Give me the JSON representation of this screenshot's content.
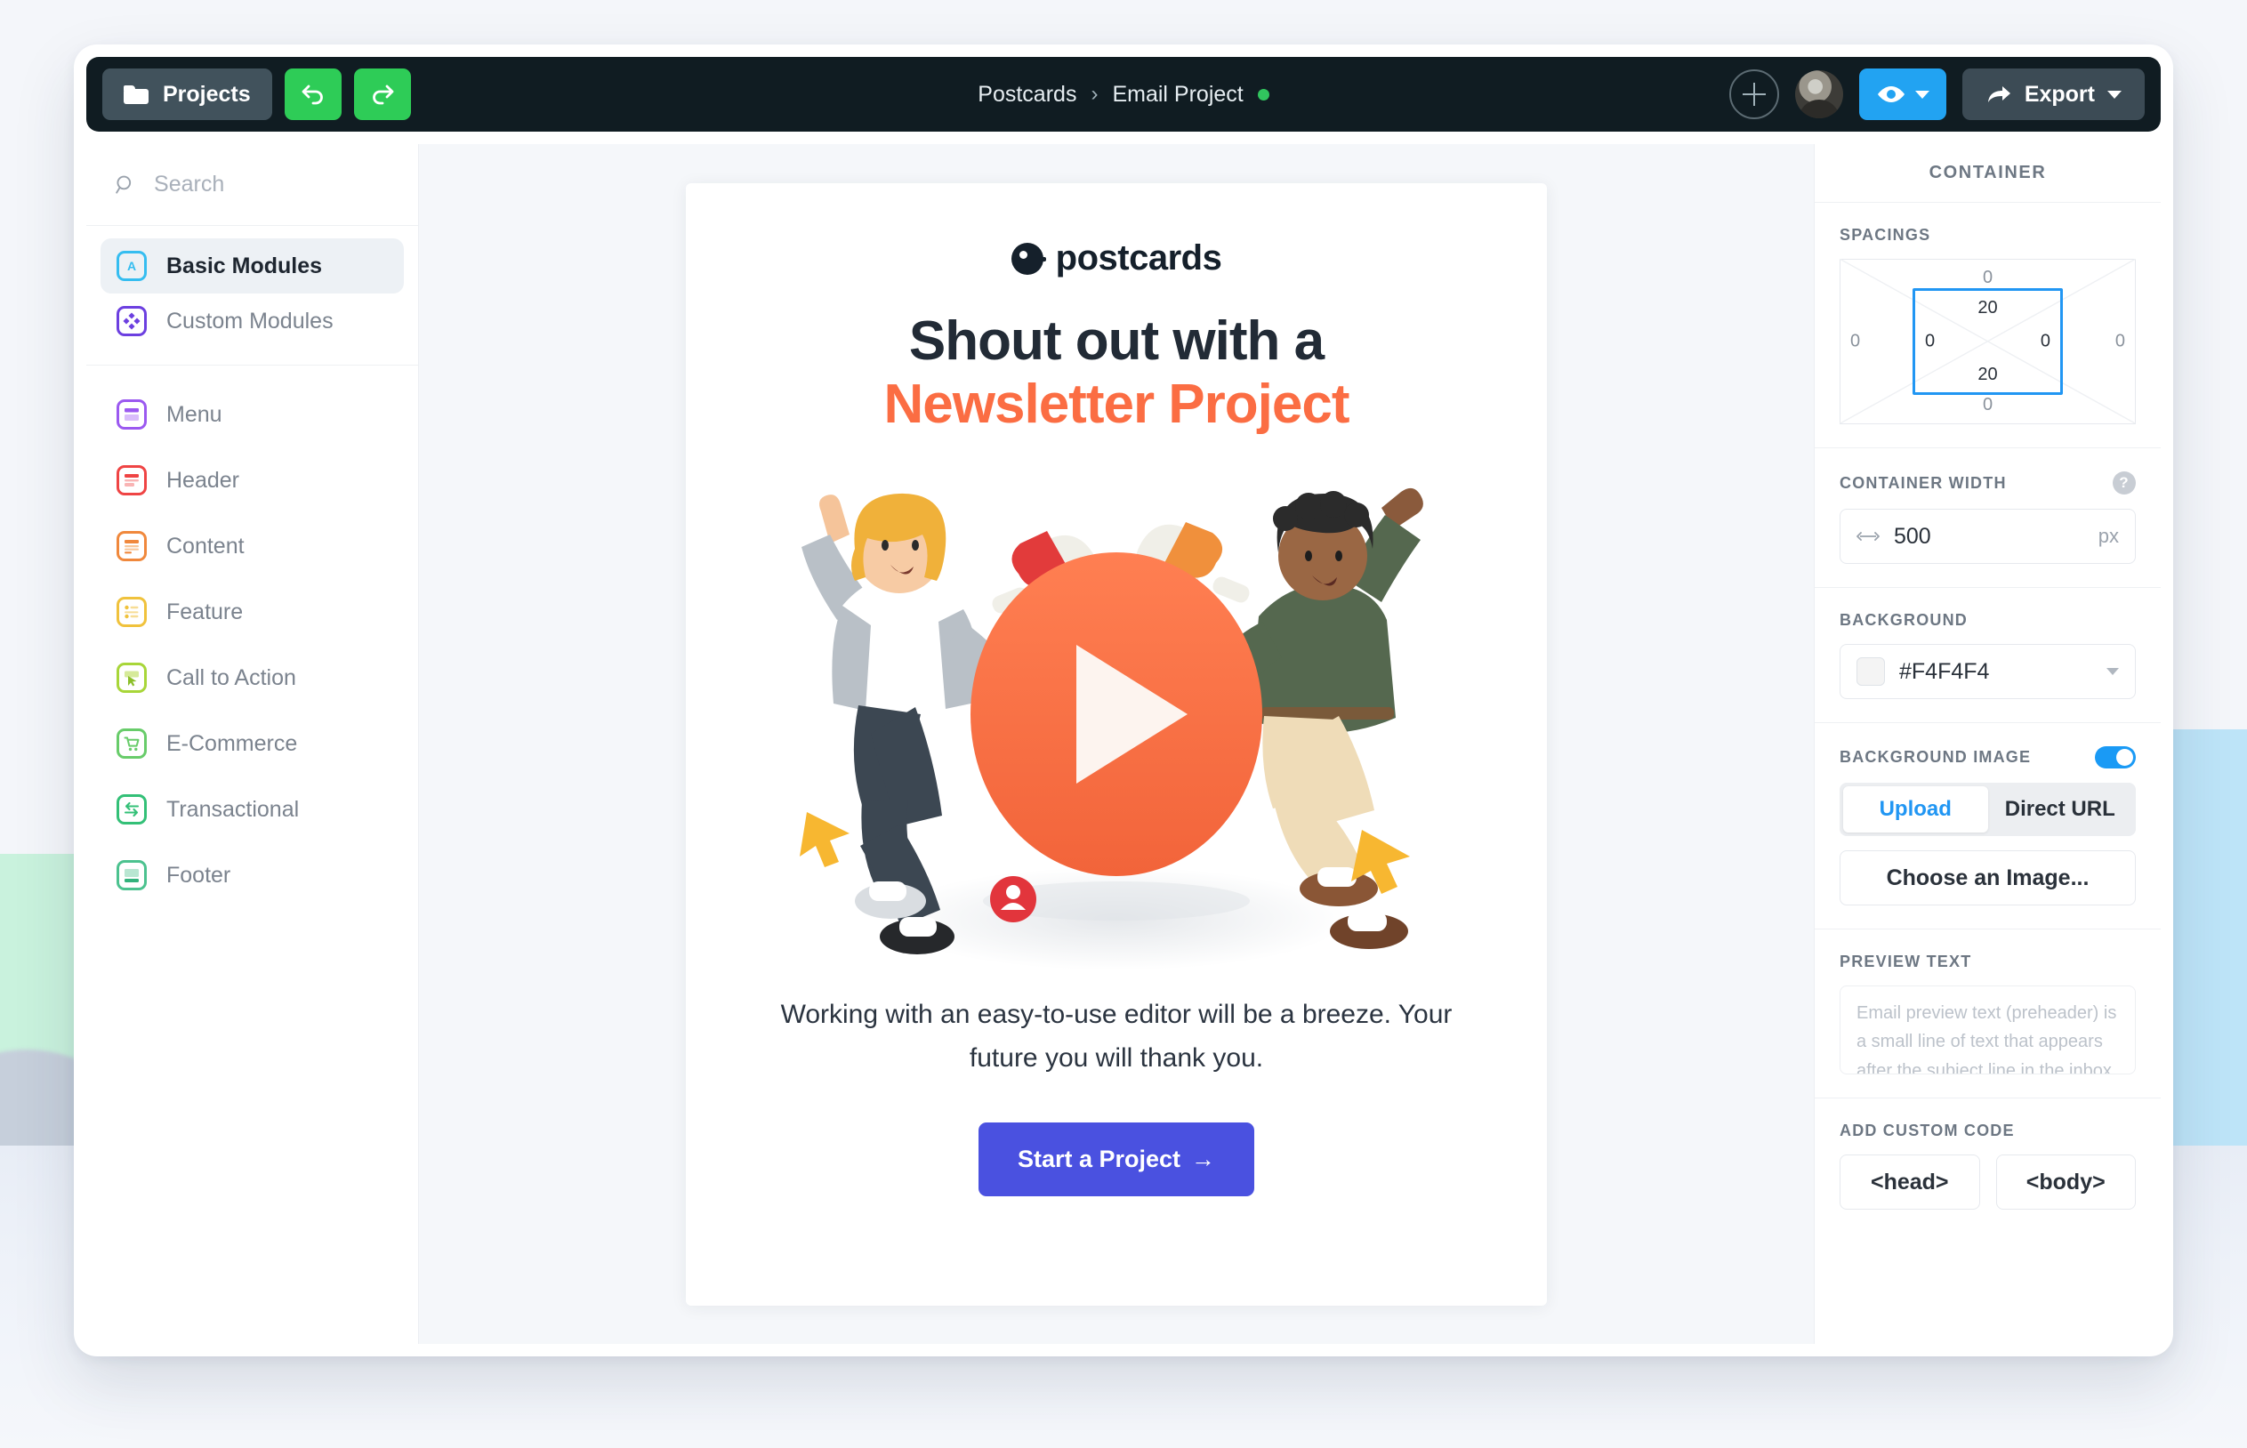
{
  "topbar": {
    "projects_label": "Projects",
    "undo_icon": "undo-arrow-icon",
    "redo_icon": "redo-arrow-icon",
    "breadcrumb": {
      "root": "Postcards",
      "separator": "›",
      "current": "Email Project"
    },
    "add_icon": "plus-circle-icon",
    "avatar_icon": "user-avatar",
    "preview_icon": "eye-icon",
    "export_label": "Export",
    "export_icon": "share-arrow-icon",
    "colors": {
      "bar": "#101c22",
      "undo_redo": "#2ecc57",
      "preview": "#22a3f2",
      "status_dot": "#31c55e"
    }
  },
  "sidebar": {
    "search": {
      "placeholder": "Search",
      "value": "",
      "icon": "search-icon"
    },
    "groups": [
      {
        "label": "Basic Modules",
        "icon": "letter-a-icon",
        "color": "#35bdf0",
        "active": true
      },
      {
        "label": "Custom Modules",
        "icon": "diamonds-icon",
        "color": "#6c3fe0",
        "active": false
      }
    ],
    "modules": [
      {
        "label": "Menu",
        "icon": "menu-module-icon",
        "color": "#9b59f0"
      },
      {
        "label": "Header",
        "icon": "header-module-icon",
        "color": "#ef4444"
      },
      {
        "label": "Content",
        "icon": "content-module-icon",
        "color": "#f0883c"
      },
      {
        "label": "Feature",
        "icon": "feature-module-icon",
        "color": "#f0c23c"
      },
      {
        "label": "Call to Action",
        "icon": "cursor-module-icon",
        "color": "#a8d639"
      },
      {
        "label": "E-Commerce",
        "icon": "cart-module-icon",
        "color": "#68cc6a"
      },
      {
        "label": "Transactional",
        "icon": "exchange-module-icon",
        "color": "#33c077"
      },
      {
        "label": "Footer",
        "icon": "footer-module-icon",
        "color": "#4cc28f"
      }
    ]
  },
  "email": {
    "brand_name": "postcards",
    "brand_icon": "postcards-logo-icon",
    "heading_line1": "Shout out with a",
    "heading_line2": "Newsletter Project",
    "heading_color": "#fb6d43",
    "hero_icon": "video-play-illustration",
    "body_text": "Working with an easy-to-use editor will be a breeze. Your future you will thank you.",
    "cta_label": "Start a Project",
    "cta_arrow": "→",
    "cta_color": "#4a51e0"
  },
  "panel": {
    "title": "CONTAINER",
    "spacings": {
      "label": "SPACINGS",
      "margin": {
        "top": "0",
        "right": "0",
        "bottom": "0",
        "left": "0"
      },
      "padding": {
        "top": "20",
        "right": "0",
        "bottom": "20",
        "left": "0"
      }
    },
    "container_width": {
      "label": "CONTAINER WIDTH",
      "value": "500",
      "unit": "px",
      "help_icon": "help-icon",
      "resize_icon": "horizontal-resize-icon"
    },
    "background": {
      "label": "BACKGROUND",
      "color_value": "#F4F4F4"
    },
    "background_image": {
      "label": "BACKGROUND IMAGE",
      "enabled": true,
      "tabs": [
        {
          "label": "Upload",
          "active": true
        },
        {
          "label": "Direct URL",
          "active": false
        }
      ],
      "choose_label": "Choose an Image..."
    },
    "preview_text": {
      "label": "PREVIEW TEXT",
      "value": "",
      "placeholder": "Email preview text (preheader) is a small line of text that appears after the subject line in the inbox."
    },
    "custom_code": {
      "label": "ADD CUSTOM CODE",
      "buttons": [
        "<head>",
        "<body>"
      ]
    }
  }
}
